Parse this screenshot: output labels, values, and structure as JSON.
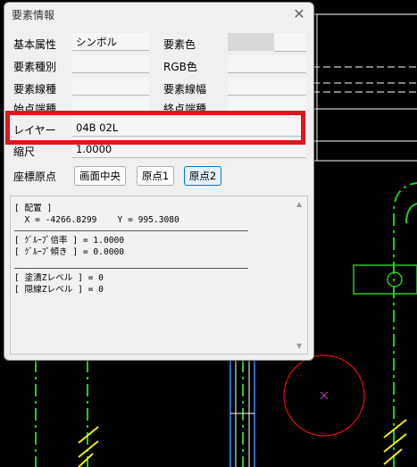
{
  "dialog": {
    "title": "要素情報",
    "close_label": "✕",
    "fields": {
      "basic_attr_label": "基本属性",
      "basic_attr_value": "シンボル",
      "elem_color_label": "要素色",
      "elem_type_label": "要素種別",
      "elem_type_value": "",
      "rgb_label": "RGB色",
      "rgb_value": "",
      "line_type_label": "要素線種",
      "line_type_value": "",
      "line_width_label": "要素線幅",
      "line_width_value": "",
      "start_label": "始点端種",
      "start_value": "",
      "end_label": "終点端種",
      "end_value": "",
      "layer_label": "レイヤー",
      "layer_value": "04B 02L",
      "scale_label": "縮尺",
      "scale_value": "1.0000"
    },
    "origin": {
      "label": "座標原点",
      "buttons": [
        "画面中央",
        "原点1",
        "原点2"
      ],
      "selected": "原点2"
    },
    "info_lines": {
      "placement_header": "[ 配置 ]",
      "coords": "  X = -4266.8299    Y = 995.3080",
      "group_scale": "[ ｸﾞﾙｰﾌﾟ倍率 ] = 1.0000",
      "group_tilt": "[ ｸﾞﾙｰﾌﾟ傾き ] = 0.0000",
      "fill_z": "[ 塗潰Zレベル ] = 0",
      "hidden_z": "[ 隠線Zレベル ] = 0"
    },
    "colors": {
      "highlight": "#e0151d",
      "selected_button_border": "#0078d7"
    }
  }
}
